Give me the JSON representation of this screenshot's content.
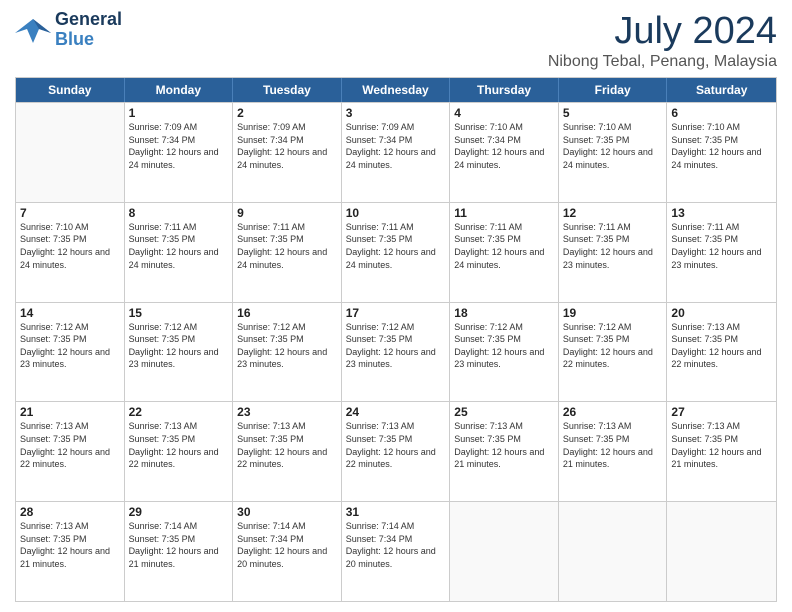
{
  "header": {
    "logo_general": "General",
    "logo_blue": "Blue",
    "month_title": "July 2024",
    "location": "Nibong Tebal, Penang, Malaysia"
  },
  "weekdays": [
    "Sunday",
    "Monday",
    "Tuesday",
    "Wednesday",
    "Thursday",
    "Friday",
    "Saturday"
  ],
  "weeks": [
    [
      {
        "day": "",
        "sunrise": "",
        "sunset": "",
        "daylight": ""
      },
      {
        "day": "1",
        "sunrise": "Sunrise: 7:09 AM",
        "sunset": "Sunset: 7:34 PM",
        "daylight": "Daylight: 12 hours and 24 minutes."
      },
      {
        "day": "2",
        "sunrise": "Sunrise: 7:09 AM",
        "sunset": "Sunset: 7:34 PM",
        "daylight": "Daylight: 12 hours and 24 minutes."
      },
      {
        "day": "3",
        "sunrise": "Sunrise: 7:09 AM",
        "sunset": "Sunset: 7:34 PM",
        "daylight": "Daylight: 12 hours and 24 minutes."
      },
      {
        "day": "4",
        "sunrise": "Sunrise: 7:10 AM",
        "sunset": "Sunset: 7:34 PM",
        "daylight": "Daylight: 12 hours and 24 minutes."
      },
      {
        "day": "5",
        "sunrise": "Sunrise: 7:10 AM",
        "sunset": "Sunset: 7:35 PM",
        "daylight": "Daylight: 12 hours and 24 minutes."
      },
      {
        "day": "6",
        "sunrise": "Sunrise: 7:10 AM",
        "sunset": "Sunset: 7:35 PM",
        "daylight": "Daylight: 12 hours and 24 minutes."
      }
    ],
    [
      {
        "day": "7",
        "sunrise": "Sunrise: 7:10 AM",
        "sunset": "Sunset: 7:35 PM",
        "daylight": "Daylight: 12 hours and 24 minutes."
      },
      {
        "day": "8",
        "sunrise": "Sunrise: 7:11 AM",
        "sunset": "Sunset: 7:35 PM",
        "daylight": "Daylight: 12 hours and 24 minutes."
      },
      {
        "day": "9",
        "sunrise": "Sunrise: 7:11 AM",
        "sunset": "Sunset: 7:35 PM",
        "daylight": "Daylight: 12 hours and 24 minutes."
      },
      {
        "day": "10",
        "sunrise": "Sunrise: 7:11 AM",
        "sunset": "Sunset: 7:35 PM",
        "daylight": "Daylight: 12 hours and 24 minutes."
      },
      {
        "day": "11",
        "sunrise": "Sunrise: 7:11 AM",
        "sunset": "Sunset: 7:35 PM",
        "daylight": "Daylight: 12 hours and 24 minutes."
      },
      {
        "day": "12",
        "sunrise": "Sunrise: 7:11 AM",
        "sunset": "Sunset: 7:35 PM",
        "daylight": "Daylight: 12 hours and 23 minutes."
      },
      {
        "day": "13",
        "sunrise": "Sunrise: 7:11 AM",
        "sunset": "Sunset: 7:35 PM",
        "daylight": "Daylight: 12 hours and 23 minutes."
      }
    ],
    [
      {
        "day": "14",
        "sunrise": "Sunrise: 7:12 AM",
        "sunset": "Sunset: 7:35 PM",
        "daylight": "Daylight: 12 hours and 23 minutes."
      },
      {
        "day": "15",
        "sunrise": "Sunrise: 7:12 AM",
        "sunset": "Sunset: 7:35 PM",
        "daylight": "Daylight: 12 hours and 23 minutes."
      },
      {
        "day": "16",
        "sunrise": "Sunrise: 7:12 AM",
        "sunset": "Sunset: 7:35 PM",
        "daylight": "Daylight: 12 hours and 23 minutes."
      },
      {
        "day": "17",
        "sunrise": "Sunrise: 7:12 AM",
        "sunset": "Sunset: 7:35 PM",
        "daylight": "Daylight: 12 hours and 23 minutes."
      },
      {
        "day": "18",
        "sunrise": "Sunrise: 7:12 AM",
        "sunset": "Sunset: 7:35 PM",
        "daylight": "Daylight: 12 hours and 23 minutes."
      },
      {
        "day": "19",
        "sunrise": "Sunrise: 7:12 AM",
        "sunset": "Sunset: 7:35 PM",
        "daylight": "Daylight: 12 hours and 22 minutes."
      },
      {
        "day": "20",
        "sunrise": "Sunrise: 7:13 AM",
        "sunset": "Sunset: 7:35 PM",
        "daylight": "Daylight: 12 hours and 22 minutes."
      }
    ],
    [
      {
        "day": "21",
        "sunrise": "Sunrise: 7:13 AM",
        "sunset": "Sunset: 7:35 PM",
        "daylight": "Daylight: 12 hours and 22 minutes."
      },
      {
        "day": "22",
        "sunrise": "Sunrise: 7:13 AM",
        "sunset": "Sunset: 7:35 PM",
        "daylight": "Daylight: 12 hours and 22 minutes."
      },
      {
        "day": "23",
        "sunrise": "Sunrise: 7:13 AM",
        "sunset": "Sunset: 7:35 PM",
        "daylight": "Daylight: 12 hours and 22 minutes."
      },
      {
        "day": "24",
        "sunrise": "Sunrise: 7:13 AM",
        "sunset": "Sunset: 7:35 PM",
        "daylight": "Daylight: 12 hours and 22 minutes."
      },
      {
        "day": "25",
        "sunrise": "Sunrise: 7:13 AM",
        "sunset": "Sunset: 7:35 PM",
        "daylight": "Daylight: 12 hours and 21 minutes."
      },
      {
        "day": "26",
        "sunrise": "Sunrise: 7:13 AM",
        "sunset": "Sunset: 7:35 PM",
        "daylight": "Daylight: 12 hours and 21 minutes."
      },
      {
        "day": "27",
        "sunrise": "Sunrise: 7:13 AM",
        "sunset": "Sunset: 7:35 PM",
        "daylight": "Daylight: 12 hours and 21 minutes."
      }
    ],
    [
      {
        "day": "28",
        "sunrise": "Sunrise: 7:13 AM",
        "sunset": "Sunset: 7:35 PM",
        "daylight": "Daylight: 12 hours and 21 minutes."
      },
      {
        "day": "29",
        "sunrise": "Sunrise: 7:14 AM",
        "sunset": "Sunset: 7:35 PM",
        "daylight": "Daylight: 12 hours and 21 minutes."
      },
      {
        "day": "30",
        "sunrise": "Sunrise: 7:14 AM",
        "sunset": "Sunset: 7:34 PM",
        "daylight": "Daylight: 12 hours and 20 minutes."
      },
      {
        "day": "31",
        "sunrise": "Sunrise: 7:14 AM",
        "sunset": "Sunset: 7:34 PM",
        "daylight": "Daylight: 12 hours and 20 minutes."
      },
      {
        "day": "",
        "sunrise": "",
        "sunset": "",
        "daylight": ""
      },
      {
        "day": "",
        "sunrise": "",
        "sunset": "",
        "daylight": ""
      },
      {
        "day": "",
        "sunrise": "",
        "sunset": "",
        "daylight": ""
      }
    ]
  ]
}
